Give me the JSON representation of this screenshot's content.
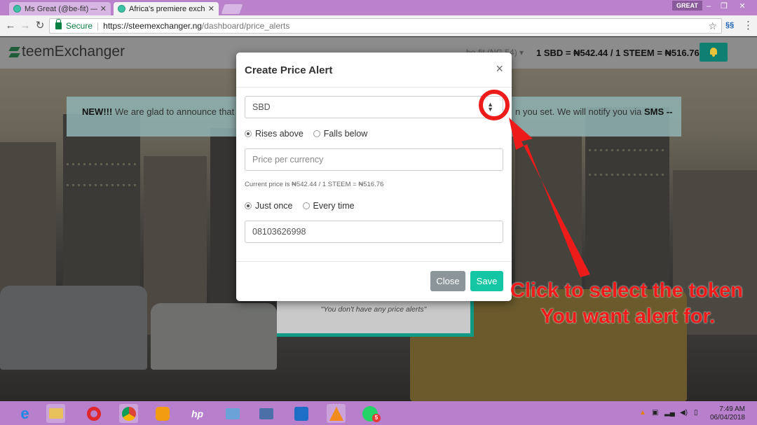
{
  "browser": {
    "tabs": [
      {
        "title": "Ms Great (@be-fit) — St",
        "active": false
      },
      {
        "title": "Africa's premiere exchan",
        "active": true
      }
    ],
    "user_badge": "GREAT",
    "secure_label": "Secure",
    "url_host": "https://steemexchanger.ng",
    "url_path": "/dashboard/price_alerts"
  },
  "header": {
    "logo_text": "teemExchanger",
    "account": "be-fit (NG 54) ▾",
    "rate": "1 SBD = ₦542.44 / 1 STEEM = ₦516.76"
  },
  "notice": {
    "strong": "NEW!!!",
    "text_left": " We are glad to announce that y",
    "text_right_prefix": "n you set. We will notify you via ",
    "text_right_strong": "SMS --"
  },
  "alerts_card": {
    "empty_text": "\"You don't have any price alerts\""
  },
  "modal": {
    "title": "Create Price Alert",
    "close_glyph": "×",
    "currency_select": "SBD",
    "direction_options": [
      {
        "label": "Rises above",
        "selected": true
      },
      {
        "label": "Falls below",
        "selected": false
      }
    ],
    "price_placeholder": "Price per currency",
    "current_price_hint": "Current price is ₦542.44 / 1 STEEM = ₦516.76",
    "frequency_options": [
      {
        "label": "Just once",
        "selected": true
      },
      {
        "label": "Every time",
        "selected": false
      }
    ],
    "phone_value": "08103626998",
    "close_button": "Close",
    "save_button": "Save"
  },
  "annotation": {
    "line1": "Click to select the token",
    "line2": "You want alert for.",
    "color": "#f11a1a"
  },
  "taskbar": {
    "time": "7:49 AM",
    "date": "06/04/2018",
    "whatsapp_badge": "5"
  }
}
